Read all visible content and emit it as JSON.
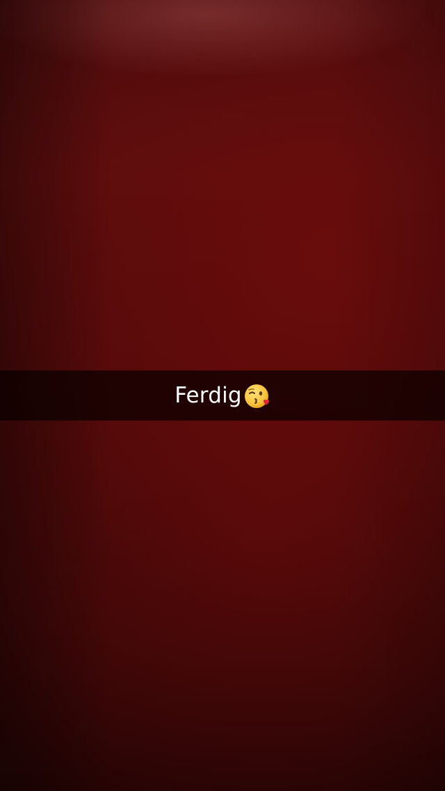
{
  "snap": {
    "caption": {
      "text": "Ferdig",
      "emoji": "kissing-face-icon"
    },
    "colors": {
      "background": "#4e0a0a",
      "caption_bar": "#0a0000"
    }
  }
}
